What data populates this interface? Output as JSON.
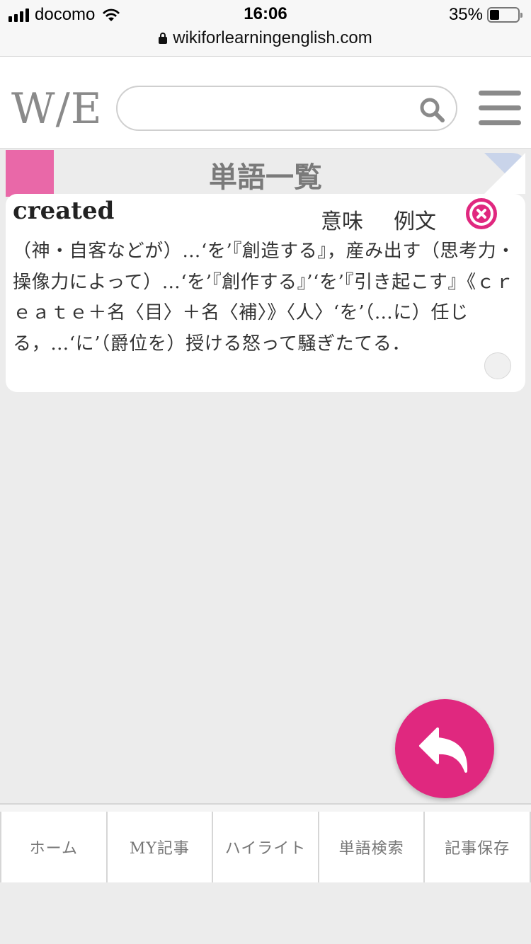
{
  "status_bar": {
    "carrier": "docomo",
    "time": "16:06",
    "battery_percent": "35%",
    "battery_level": 0.35,
    "url": "wikiforlearningenglish.com"
  },
  "header": {
    "logo": "W/E",
    "search_placeholder": "",
    "search_value": ""
  },
  "section": {
    "title": "単語一覧"
  },
  "word_card": {
    "word": "created",
    "tab_meaning": "意味",
    "tab_example": "例文",
    "definition": "（神・自客などが）…‘を’『創造する』，産み出す（思考力・操像力によって）…‘を’『創作する』’‘を’『引き起こす』《ｃｒｅａｔｅ＋名〈目〉＋名〈補〉》〈人〉‘を’（…に）任じる，…‘に’（爵位を）授ける怒って騒ぎたてる．"
  },
  "bottom_nav": {
    "items": [
      {
        "label": "ホーム"
      },
      {
        "label": "MY記事"
      },
      {
        "label": "ハイライト"
      },
      {
        "label": "単語検索"
      },
      {
        "label": "記事保存"
      }
    ]
  },
  "colors": {
    "accent": "#e0287f",
    "pink_square": "#e968a8",
    "corner_fold": "#c9d4ea"
  }
}
